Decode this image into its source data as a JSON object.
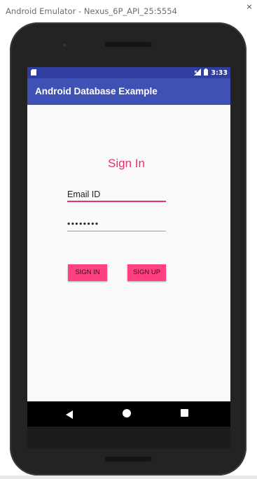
{
  "window": {
    "title": "Android Emulator - Nexus_6P_API_25:5554",
    "close_glyph": "×"
  },
  "status_bar": {
    "time": "3:33",
    "icons": [
      "sd-card-icon",
      "signal-icon",
      "battery-icon"
    ]
  },
  "app_bar": {
    "title": "Android Database Example"
  },
  "form": {
    "heading": "Sign In",
    "email_field": {
      "value": "Email ID"
    },
    "password_field": {
      "value": "••••••••"
    },
    "sign_in_label": "SIGN IN",
    "sign_up_label": "SIGN UP"
  },
  "navigation": {
    "buttons": [
      "back-icon",
      "home-icon",
      "recents-icon"
    ]
  },
  "colors": {
    "primary": "#3f51b5",
    "primary_dark": "#303f9f",
    "accent": "#ff4081",
    "heading": "#e0336e"
  }
}
